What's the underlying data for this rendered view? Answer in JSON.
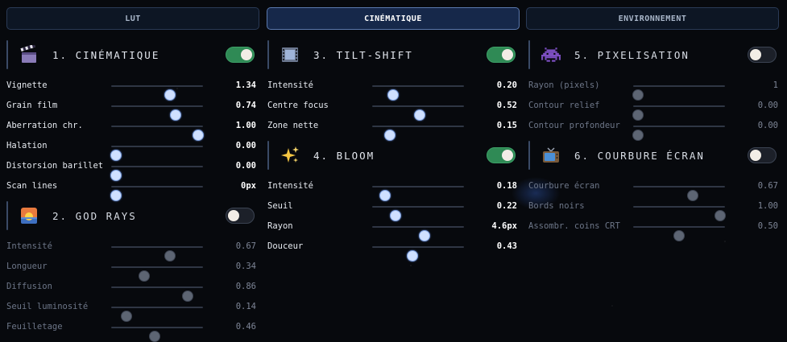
{
  "tabs": [
    {
      "label": "LUT"
    },
    {
      "label": "CINÉMATIQUE"
    },
    {
      "label": "ENVIRONNEMENT"
    }
  ],
  "sections": {
    "cine": {
      "title": "1. CINÉMATIQUE",
      "icon": "clapperboard-icon",
      "enabled": true,
      "rows": [
        {
          "label": "Vignette",
          "value": "1.34",
          "level": 0.64
        },
        {
          "label": "Grain film",
          "value": "0.74",
          "level": 0.7
        },
        {
          "label": "Aberration chr.",
          "value": "1.00",
          "level": 0.95
        },
        {
          "label": "Halation",
          "value": "0.00",
          "level": 0.05
        },
        {
          "label": "Distorsion barillet",
          "value": "0.00",
          "level": 0.05
        },
        {
          "label": "Scan lines",
          "value": "0px",
          "level": 0.05
        }
      ]
    },
    "godrays": {
      "title": "2. GOD RAYS",
      "icon": "sunset-icon",
      "enabled": false,
      "rows": [
        {
          "label": "Intensité",
          "value": "0.67",
          "level": 0.64
        },
        {
          "label": "Longueur",
          "value": "0.34",
          "level": 0.36
        },
        {
          "label": "Diffusion",
          "value": "0.86",
          "level": 0.83
        },
        {
          "label": "Seuil luminosité",
          "value": "0.14",
          "level": 0.17
        },
        {
          "label": "Feuilletage",
          "value": "0.46",
          "level": 0.47
        }
      ]
    },
    "tilt": {
      "title": "3. TILT-SHIFT",
      "icon": "film-icon",
      "enabled": true,
      "rows": [
        {
          "label": "Intensité",
          "value": "0.20",
          "level": 0.23
        },
        {
          "label": "Centre focus",
          "value": "0.52",
          "level": 0.52
        },
        {
          "label": "Zone nette",
          "value": "0.15",
          "level": 0.19
        }
      ]
    },
    "bloom": {
      "title": "4. BLOOM",
      "icon": "sparkles-icon",
      "enabled": true,
      "rows": [
        {
          "label": "Intensité",
          "value": "0.18",
          "level": 0.14
        },
        {
          "label": "Seuil",
          "value": "0.22",
          "level": 0.25
        },
        {
          "label": "Rayon",
          "value": "4.6px",
          "level": 0.57
        },
        {
          "label": "Douceur",
          "value": "0.43",
          "level": 0.44
        }
      ]
    },
    "pixel": {
      "title": "5. PIXELISATION",
      "icon": "space-invader-icon",
      "enabled": false,
      "rows": [
        {
          "label": "Rayon (pixels)",
          "value": "1",
          "level": 0.05
        },
        {
          "label": "Contour relief",
          "value": "0.00",
          "level": 0.05
        },
        {
          "label": "Contour profondeur",
          "value": "0.00",
          "level": 0.05
        }
      ]
    },
    "curve": {
      "title": "6. COURBURE ÉCRAN",
      "icon": "tv-icon",
      "enabled": false,
      "rows": [
        {
          "label": "Courbure écran",
          "value": "0.67",
          "level": 0.65
        },
        {
          "label": "Bords noirs",
          "value": "1.00",
          "level": 0.95
        },
        {
          "label": "Assombr. coins CRT",
          "value": "0.50",
          "level": 0.5
        }
      ]
    }
  }
}
